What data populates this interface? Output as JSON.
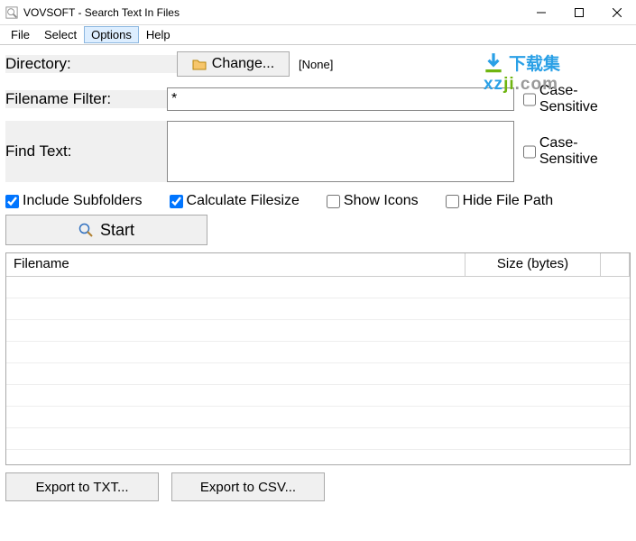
{
  "window": {
    "title": "VOVSOFT - Search Text In Files"
  },
  "menu": {
    "file": "File",
    "select": "Select",
    "options": "Options",
    "help": "Help"
  },
  "labels": {
    "directory": "Directory:",
    "filename_filter": "Filename Filter:",
    "find_text": "Find Text:"
  },
  "directory": {
    "change_btn": "Change...",
    "current": "[None]"
  },
  "filter": {
    "value": "*",
    "case_sensitive_label": "Case-Sensitive",
    "case_sensitive": false
  },
  "find": {
    "value": "",
    "case_sensitive_label": "Case-Sensitive",
    "case_sensitive": false
  },
  "options": {
    "include_subfolders": {
      "label": "Include Subfolders",
      "checked": true
    },
    "calculate_filesize": {
      "label": "Calculate Filesize",
      "checked": true
    },
    "show_icons": {
      "label": "Show Icons",
      "checked": false
    },
    "hide_file_path": {
      "label": "Hide File Path",
      "checked": false
    }
  },
  "start_btn": "Start",
  "grid": {
    "columns": {
      "filename": "Filename",
      "size": "Size (bytes)"
    }
  },
  "export": {
    "txt": "Export to TXT...",
    "csv": "Export to CSV..."
  },
  "watermark": {
    "cn": "下载集",
    "url_a": "xz",
    "url_b": "ji",
    "url_c": ".com"
  }
}
